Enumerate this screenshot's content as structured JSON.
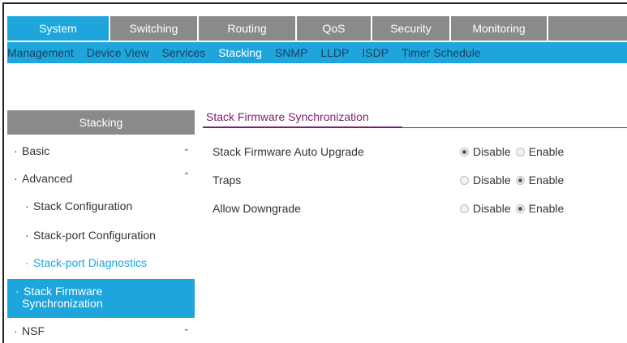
{
  "top_tabs": [
    {
      "label": "System",
      "active": true
    },
    {
      "label": "Switching",
      "active": false
    },
    {
      "label": "Routing",
      "active": false
    },
    {
      "label": "QoS",
      "active": false
    },
    {
      "label": "Security",
      "active": false
    },
    {
      "label": "Monitoring",
      "active": false
    }
  ],
  "sub_tabs": [
    {
      "label": "Management",
      "active": false
    },
    {
      "label": "Device View",
      "active": false
    },
    {
      "label": "Services",
      "active": false
    },
    {
      "label": "Stacking",
      "active": true
    },
    {
      "label": "SNMP",
      "active": false
    },
    {
      "label": "LLDP",
      "active": false
    },
    {
      "label": "ISDP",
      "active": false
    },
    {
      "label": "Timer Schedule",
      "active": false
    }
  ],
  "sidebar": {
    "header": "Stacking",
    "items": [
      {
        "label": "Basic",
        "icon": "chevron-down"
      },
      {
        "label": "Advanced",
        "icon": "chevron-up"
      },
      {
        "label": "Stack Configuration"
      },
      {
        "label": "Stack-port Configuration"
      },
      {
        "label": "Stack-port Diagnostics"
      },
      {
        "label": "Stack Firmware Synchronization"
      },
      {
        "label": "NSF",
        "icon": "chevron-down"
      }
    ]
  },
  "content": {
    "title": "Stack Firmware Synchronization",
    "rows": [
      {
        "label": "Stack Firmware Auto Upgrade",
        "options": [
          "Disable",
          "Enable"
        ],
        "selected": "Disable"
      },
      {
        "label": "Traps",
        "options": [
          "Disable",
          "Enable"
        ],
        "selected": "Enable"
      },
      {
        "label": "Allow Downgrade",
        "options": [
          "Disable",
          "Enable"
        ],
        "selected": "Enable"
      }
    ]
  },
  "colors": {
    "accent": "#1ea6dc",
    "tab_inactive": "#8a8a8a",
    "title": "#7a1f6e"
  }
}
